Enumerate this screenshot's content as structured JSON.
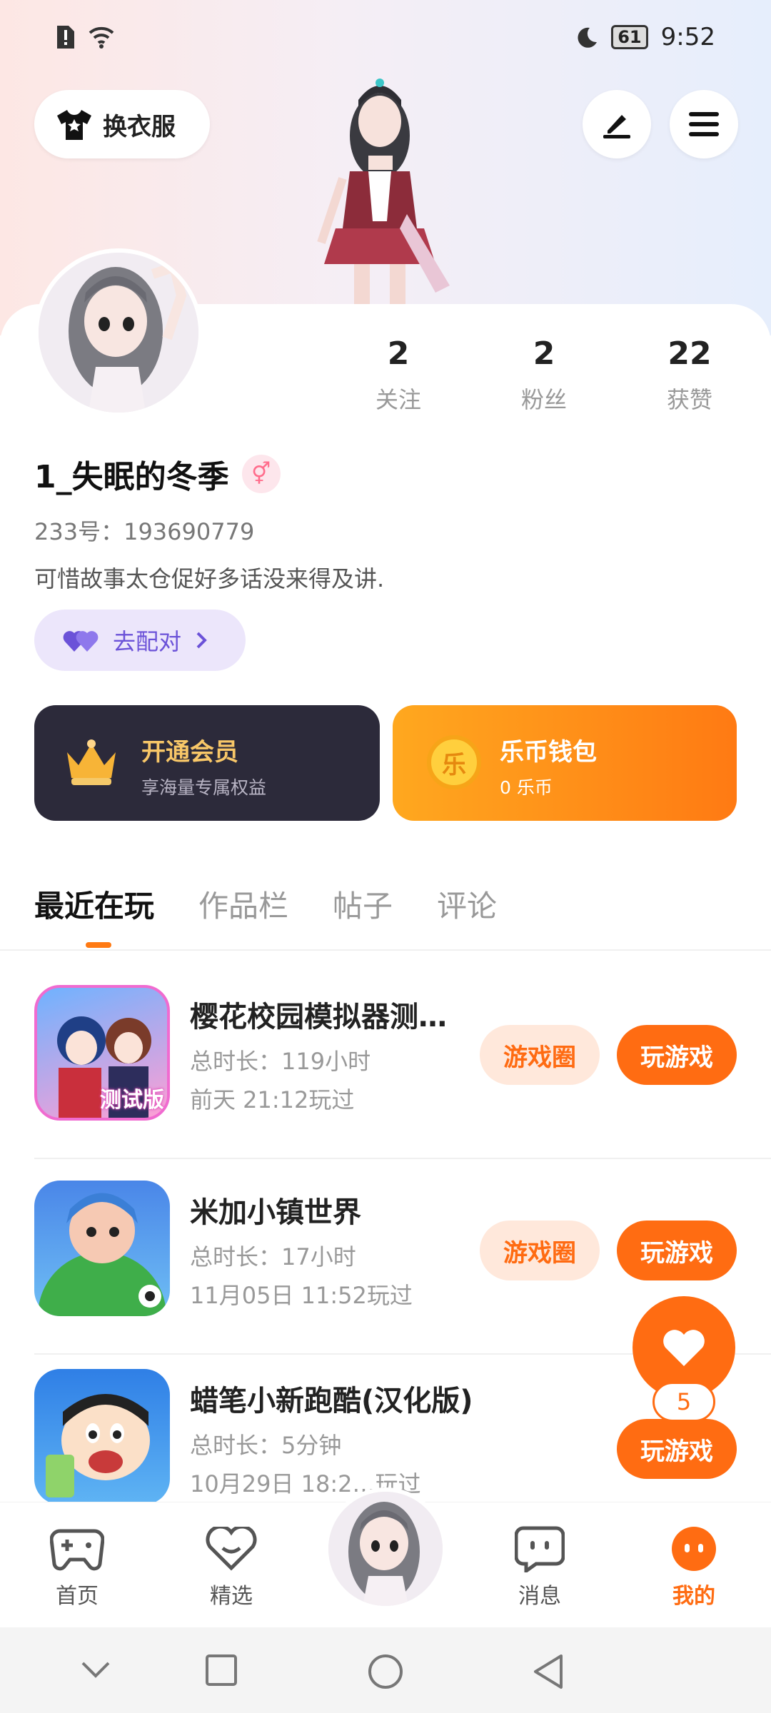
{
  "status_bar": {
    "battery": "61",
    "time": "9:52"
  },
  "header": {
    "dress_button_label": "换衣服"
  },
  "profile": {
    "stats": [
      {
        "value": "2",
        "label": "关注"
      },
      {
        "value": "2",
        "label": "粉丝"
      },
      {
        "value": "22",
        "label": "获赞"
      }
    ],
    "name": "1_失眠的冬季",
    "gender_symbol": "⚥",
    "id_text": "233号：193690779",
    "bio": "可惜故事太仓促好多话没来得及讲.",
    "match_label": "去配对"
  },
  "promos": {
    "vip": {
      "title": "开通会员",
      "subtitle": "享海量专属权益"
    },
    "wallet": {
      "title": "乐币钱包",
      "subtitle": "0 乐币",
      "coin_char": "乐"
    }
  },
  "tabs": [
    "最近在玩",
    "作品栏",
    "帖子",
    "评论"
  ],
  "games": [
    {
      "title": "樱花校园模拟器测…",
      "duration": "总时长：119小时",
      "last_played": "前天 21:12玩过",
      "circle_label": "游戏圈",
      "play_label": "玩游戏",
      "icon_badge": "测试版"
    },
    {
      "title": "米加小镇世界",
      "duration": "总时长：17小时",
      "last_played": "11月05日 11:52玩过",
      "circle_label": "游戏圈",
      "play_label": "玩游戏"
    },
    {
      "title": "蜡笔小新跑酷(汉化版)",
      "duration": "总时长：5分钟",
      "last_played": "10月29日 18:2…玩过",
      "play_label": "玩游戏"
    }
  ],
  "fab": {
    "count": "5"
  },
  "bottom_nav": [
    {
      "label": "首页"
    },
    {
      "label": "精选"
    },
    {
      "label": "消息"
    },
    {
      "label": "我的"
    }
  ],
  "colors": {
    "accent": "#ff6c12",
    "vip_bg": "#2c2a3a",
    "match_bg": "#ece6fb"
  }
}
